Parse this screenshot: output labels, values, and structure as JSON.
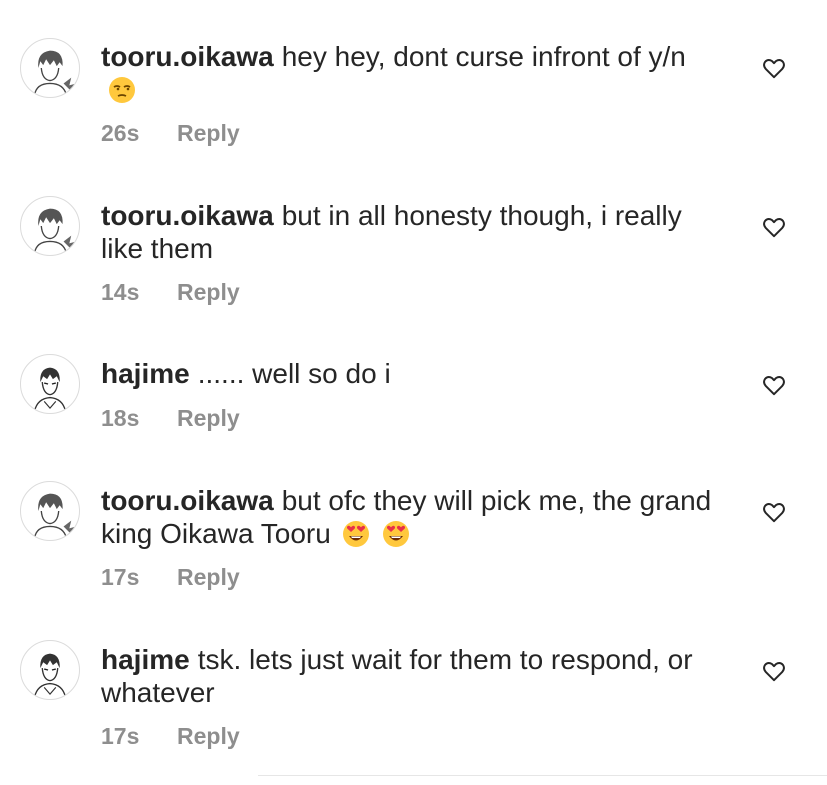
{
  "comments": [
    {
      "username": "tooru.oikawa",
      "text": "hey hey, dont curse infront of y/n",
      "emojis": [
        "unamused-face"
      ],
      "time": "26s",
      "reply_label": "Reply",
      "avatar": "oikawa-avatar"
    },
    {
      "username": "tooru.oikawa",
      "text": "but in all honesty though, i really like them",
      "emojis": [],
      "time": "14s",
      "reply_label": "Reply",
      "avatar": "oikawa-avatar"
    },
    {
      "username": "hajime",
      "text": "...... well so do i",
      "emojis": [],
      "time": "18s",
      "reply_label": "Reply",
      "avatar": "hajime-avatar"
    },
    {
      "username": "tooru.oikawa",
      "text": "but ofc they will pick me, the grand king Oikawa Tooru",
      "emojis": [
        "heart-eyes-face",
        "heart-eyes-face"
      ],
      "time": "17s",
      "reply_label": "Reply",
      "avatar": "oikawa-avatar"
    },
    {
      "username": "hajime",
      "text": "tsk. lets just wait for them to respond, or whatever",
      "emojis": [],
      "time": "17s",
      "reply_label": "Reply",
      "avatar": "hajime-avatar"
    }
  ],
  "icons": {
    "like": "heart-outline-icon"
  },
  "colors": {
    "text": "#262626",
    "meta": "#8e8e8e",
    "emoji_face": "#FFC83D"
  }
}
